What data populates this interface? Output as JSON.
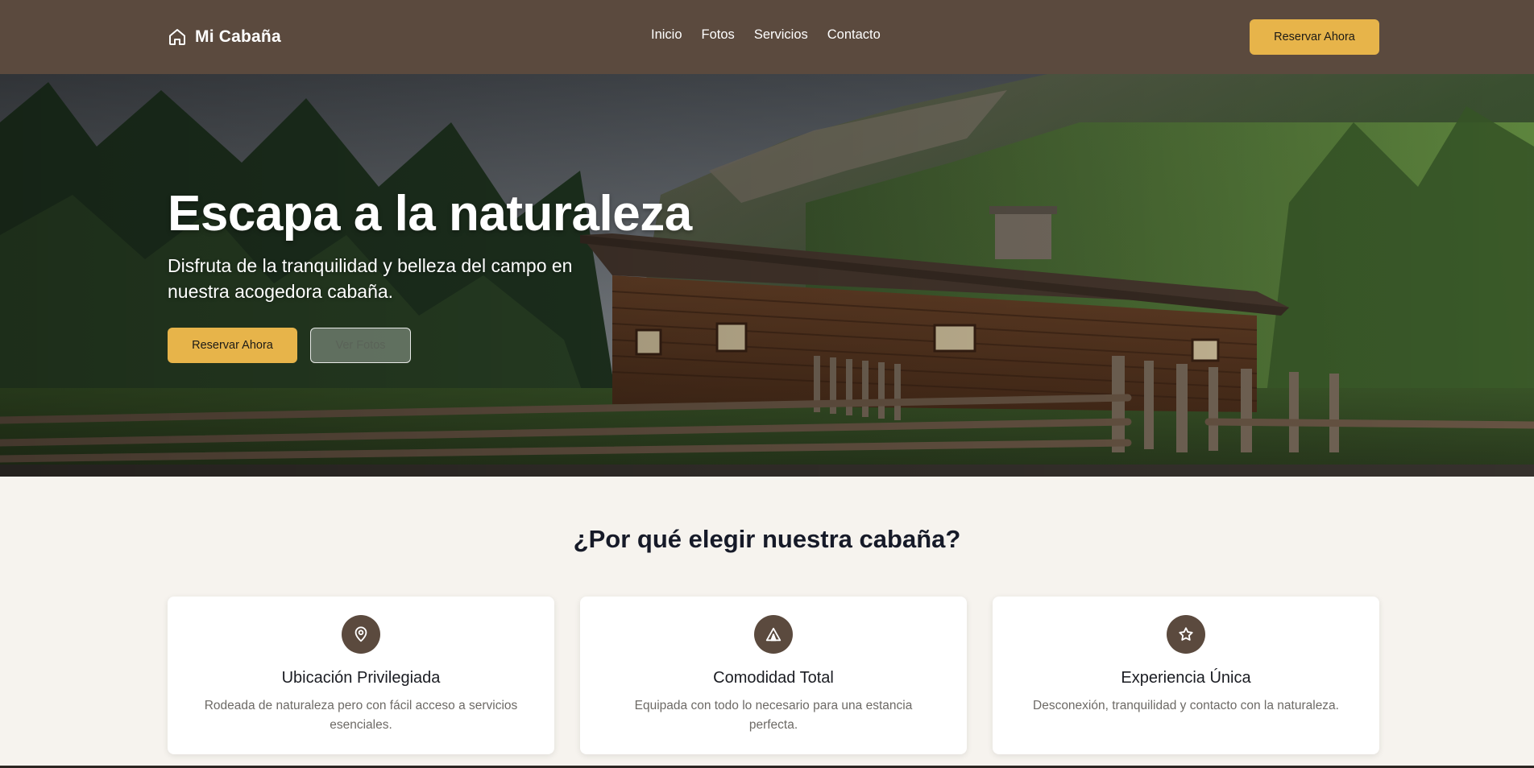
{
  "navbar": {
    "brand": "Mi Cabaña",
    "links": [
      "Inicio",
      "Fotos",
      "Servicios",
      "Contacto"
    ],
    "cta_label": "Reservar Ahora"
  },
  "hero": {
    "title": "Escapa a la naturaleza",
    "subtitle": "Disfruta de la tranquilidad y belleza del campo en nuestra acogedora cabaña.",
    "primary_button": "Reservar Ahora",
    "secondary_button": "Ver Fotos"
  },
  "features": {
    "title": "¿Por qué elegir nuestra cabaña?",
    "cards": [
      {
        "icon": "map-pin-icon",
        "title": "Ubicación Privilegiada",
        "description": "Rodeada de naturaleza pero con fácil acceso a servicios esenciales."
      },
      {
        "icon": "tent-icon",
        "title": "Comodidad Total",
        "description": "Equipada con todo lo necesario para una estancia perfecta."
      },
      {
        "icon": "star-icon",
        "title": "Experiencia Única",
        "description": "Desconexión, tranquilidad y contacto con la naturaleza."
      }
    ]
  },
  "colors": {
    "navbar_bg": "#5b4a3e",
    "accent": "#e7b44a",
    "page_bg": "#f6f3ee"
  }
}
